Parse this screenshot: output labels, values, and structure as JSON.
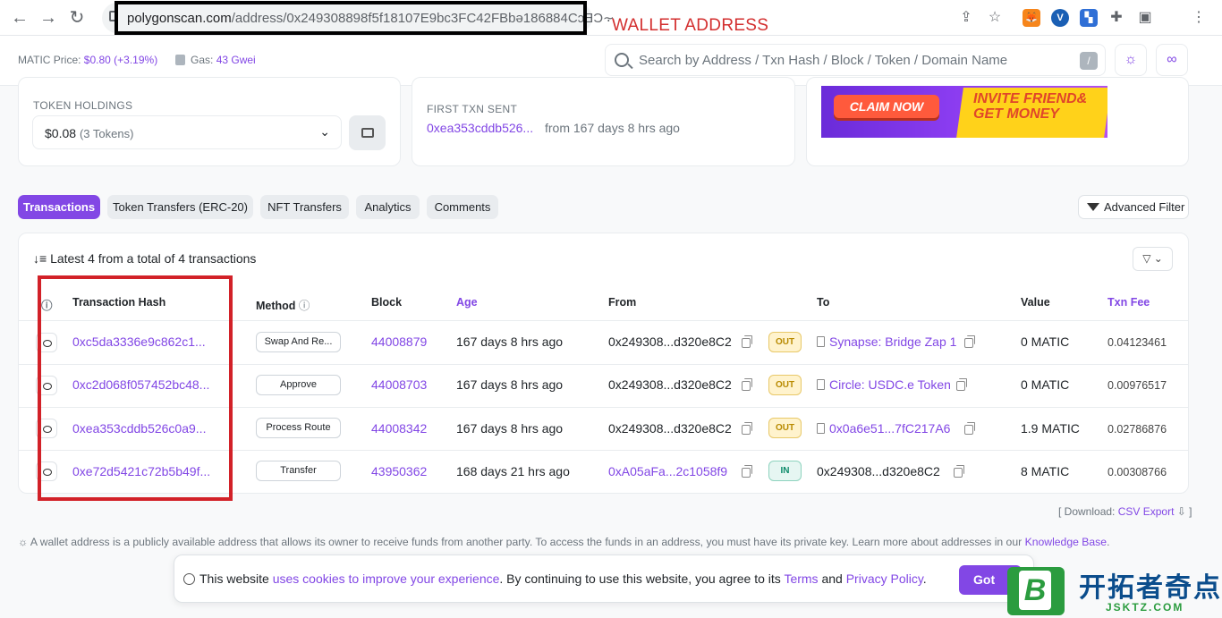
{
  "browser": {
    "url_host": "polygonscan.com",
    "url_path": "/address/0x249308898f5f18107E9bc3FC42FBbə186884CɔƎƆ⸟",
    "annotation_label": "WALLET ADDRESS"
  },
  "topbar": {
    "price_label": "MATIC Price:",
    "price_value": "$0.80",
    "price_change": "(+3.19%)",
    "gas_label": "Gas:",
    "gas_value": "43 Gwei",
    "search_placeholder": "Search by Address / Txn Hash / Block / Token / Domain Name",
    "search_shortcut": "/"
  },
  "overview": {
    "token_holdings_label": "TOKEN HOLDINGS",
    "token_holdings_value": "$0.08",
    "token_holdings_count": "(3 Tokens)",
    "first_txn_label": "FIRST TXN SENT",
    "first_txn_hash": "0xea353cddb526...",
    "first_txn_time": "from 167 days 8 hrs ago",
    "ad_claim": "CLAIM NOW",
    "ad_invite": "INVITE FRIEND&",
    "ad_money": "GET MONEY"
  },
  "tabs": [
    "Transactions",
    "Token Transfers (ERC-20)",
    "NFT Transfers",
    "Analytics",
    "Comments"
  ],
  "advanced_filter": "Advanced Filter",
  "table": {
    "summary": "Latest 4 from a total of 4 transactions",
    "headers": {
      "hash": "Transaction Hash",
      "method": "Method",
      "block": "Block",
      "age": "Age",
      "from": "From",
      "to": "To",
      "value": "Value",
      "fee": "Txn Fee"
    },
    "rows": [
      {
        "hash": "0xc5da3336e9c862c1...",
        "method": "Swap And Re...",
        "block": "44008879",
        "age": "167 days 8 hrs ago",
        "from": "0x249308...d320e8C2",
        "dir": "OUT",
        "to": "Synapse: Bridge Zap 1",
        "value": "0 MATIC",
        "fee": "0.04123461"
      },
      {
        "hash": "0xc2d068f057452bc48...",
        "method": "Approve",
        "block": "44008703",
        "age": "167 days 8 hrs ago",
        "from": "0x249308...d320e8C2",
        "dir": "OUT",
        "to": "Circle: USDC.e Token",
        "value": "0 MATIC",
        "fee": "0.00976517"
      },
      {
        "hash": "0xea353cddb526c0a9...",
        "method": "Process Route",
        "block": "44008342",
        "age": "167 days 8 hrs ago",
        "from": "0x249308...d320e8C2",
        "dir": "OUT",
        "to": "0x0a6e51...7fC217A6",
        "value": "1.9 MATIC",
        "fee": "0.02786876"
      },
      {
        "hash": "0xe72d5421c72b5b49f...",
        "method": "Transfer",
        "block": "43950362",
        "age": "168 days 21 hrs ago",
        "from": "0xA05aFa...2c1058f9",
        "dir": "IN",
        "to": "0x249308...d320e8C2",
        "value": "8 MATIC",
        "fee": "0.00308766"
      }
    ]
  },
  "download": {
    "prefix": "[ Download:",
    "link": "CSV Export",
    "suffix": "]"
  },
  "info_text": "A wallet address is a publicly available address that allows its owner to receive funds from another party. To access the funds in an address, you must have its private key. Learn more about addresses in our",
  "info_link": "Knowledge Base",
  "cookie": {
    "t1": "This website",
    "l1": "uses cookies to improve your experience",
    "t2": ". By continuing to use this website, you agree to its",
    "l2": "Terms",
    "t3": "and",
    "l3": "Privacy Policy",
    "t4": ".",
    "button": "Got"
  },
  "watermark": {
    "mark": "B",
    "cn": "开拓者奇点",
    "sub": "JSKTZ.COM"
  },
  "colors": {
    "accent": "#8247e5",
    "annotation_red": "#d22128"
  }
}
